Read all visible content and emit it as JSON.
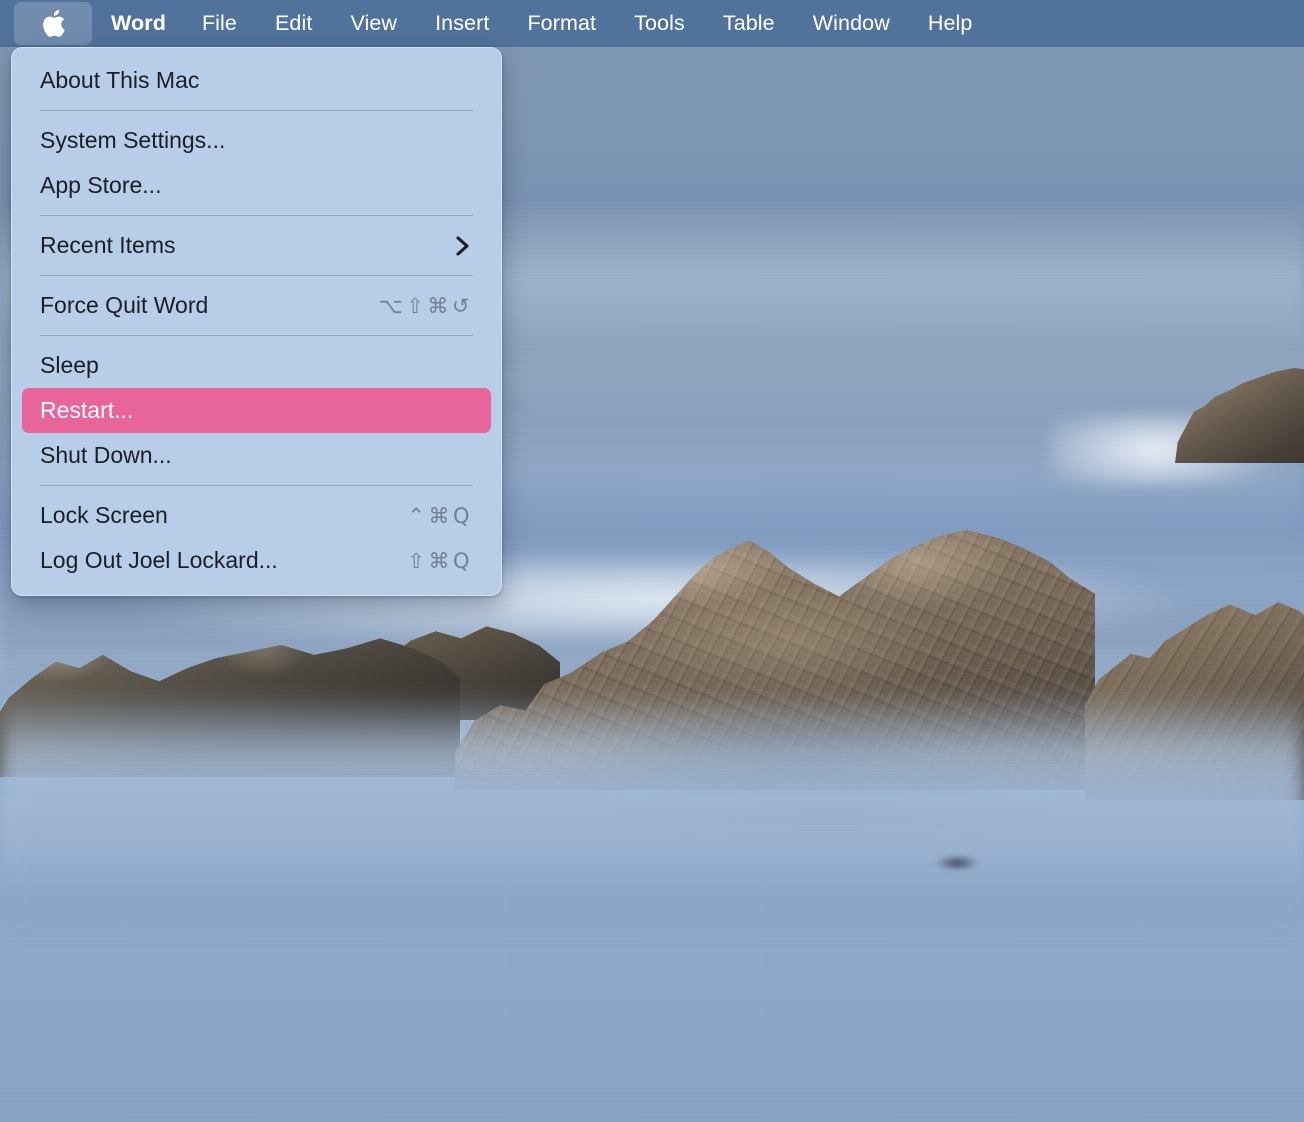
{
  "menubar": {
    "apple_icon": "apple-logo-icon",
    "items": [
      {
        "label": "Word",
        "bold": true
      },
      {
        "label": "File",
        "bold": false
      },
      {
        "label": "Edit",
        "bold": false
      },
      {
        "label": "View",
        "bold": false
      },
      {
        "label": "Insert",
        "bold": false
      },
      {
        "label": "Format",
        "bold": false
      },
      {
        "label": "Tools",
        "bold": false
      },
      {
        "label": "Table",
        "bold": false
      },
      {
        "label": "Window",
        "bold": false
      },
      {
        "label": "Help",
        "bold": false
      }
    ]
  },
  "apple_menu": {
    "items": {
      "about_this_mac": "About This Mac",
      "system_settings": "System Settings...",
      "app_store": "App Store...",
      "recent_items": "Recent Items",
      "force_quit_word": "Force Quit Word",
      "sleep": "Sleep",
      "restart": "Restart...",
      "shut_down": "Shut Down...",
      "lock_screen": "Lock Screen",
      "log_out": "Log Out Joel Lockard..."
    },
    "shortcuts": {
      "force_quit_word": "⌥⇧⌘↺",
      "lock_screen": "⌃⌘Q",
      "log_out": "⇧⌘Q"
    },
    "submenu_indicator": "chevron-right-icon",
    "selected_item": "Restart...",
    "user_name": "Joel Lockard"
  },
  "colors": {
    "menubar_background": "#51729a",
    "menu_background": "#b7cde8",
    "menu_text": "#1b1f25",
    "shortcut_text": "#72808f",
    "highlight": "#e8659b",
    "highlight_text": "#ffffff",
    "separator": "#6a7e96",
    "wallpaper_sea": "#8ba6c8",
    "wallpaper_rock": "#6a5c4d"
  },
  "wallpaper": {
    "description": "Coastal seascape with rocky outcrops in misty blue water"
  }
}
